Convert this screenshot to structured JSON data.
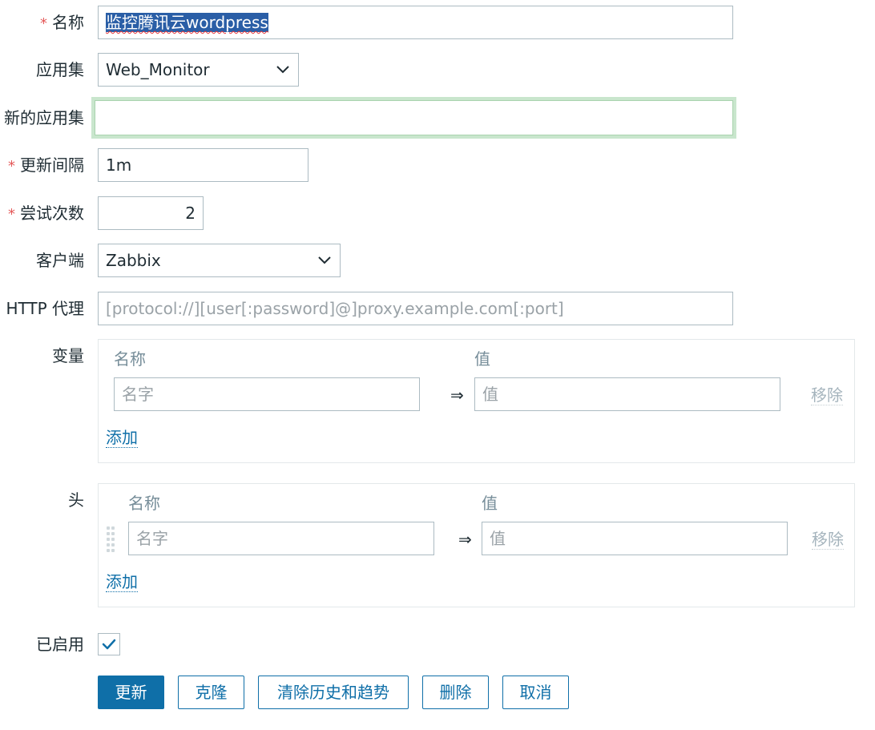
{
  "form": {
    "name": {
      "label": "名称",
      "value": "监控腾讯云wordpress"
    },
    "application": {
      "label": "应用集",
      "value": "Web_Monitor",
      "icon": "chevron-down-icon"
    },
    "new_application": {
      "label": "新的应用集",
      "value": ""
    },
    "update_interval": {
      "label": "更新间隔",
      "value": "1m"
    },
    "attempts": {
      "label": "尝试次数",
      "value": "2"
    },
    "agent": {
      "label": "客户端",
      "value": "Zabbix",
      "icon": "chevron-down-icon"
    },
    "http_proxy": {
      "label": "HTTP 代理",
      "placeholder": "[protocol://][user[:password]@]proxy.example.com[:port]"
    },
    "variables": {
      "label": "变量",
      "col_name": "名称",
      "col_value": "值",
      "name_placeholder": "名字",
      "arrow": "⇒",
      "value_placeholder": "值",
      "remove": "移除",
      "add": "添加"
    },
    "headers": {
      "label": "头",
      "col_name": "名称",
      "col_value": "值",
      "name_placeholder": "名字",
      "arrow": "⇒",
      "value_placeholder": "值",
      "remove": "移除",
      "add": "添加"
    },
    "enabled": {
      "label": "已启用",
      "checked": true
    },
    "required_mark": "*"
  },
  "buttons": {
    "update": "更新",
    "clone": "克隆",
    "clear": "清除历史和趋势",
    "delete": "删除",
    "cancel": "取消"
  },
  "colors": {
    "primary": "#0f6fa8",
    "required": "#e45959",
    "focus_glow": "#c9e6cd",
    "selection": "#2a5ea6"
  }
}
